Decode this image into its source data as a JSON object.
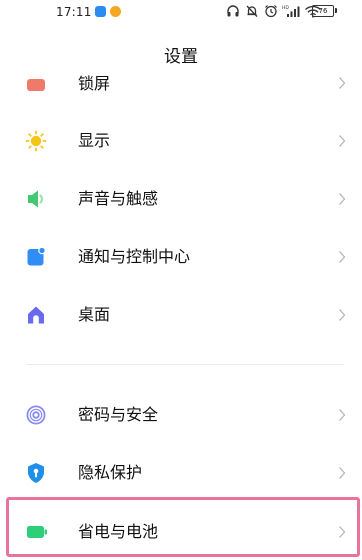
{
  "status_bar": {
    "time": "17:11",
    "battery": "76"
  },
  "header": {
    "title": "设置"
  },
  "settings": [
    {
      "label": "锁屏",
      "icon": "lock-screen-icon",
      "color": "#f07a6a"
    },
    {
      "label": "显示",
      "icon": "sun-icon",
      "color": "#f5c518"
    },
    {
      "label": "声音与触感",
      "icon": "speaker-icon",
      "color": "#43c873"
    },
    {
      "label": "通知与控制中心",
      "icon": "notification-icon",
      "color": "#2f8df5"
    },
    {
      "label": "桌面",
      "icon": "home-icon",
      "color": "#6a6af0"
    },
    {
      "label": "密码与安全",
      "icon": "fingerprint-icon",
      "color": "#6c6ee8"
    },
    {
      "label": "隐私保护",
      "icon": "privacy-shield-icon",
      "color": "#1e90e8"
    },
    {
      "label": "省电与电池",
      "icon": "battery-icon",
      "color": "#2fcf7a"
    }
  ],
  "highlight_color": "#e9739c"
}
